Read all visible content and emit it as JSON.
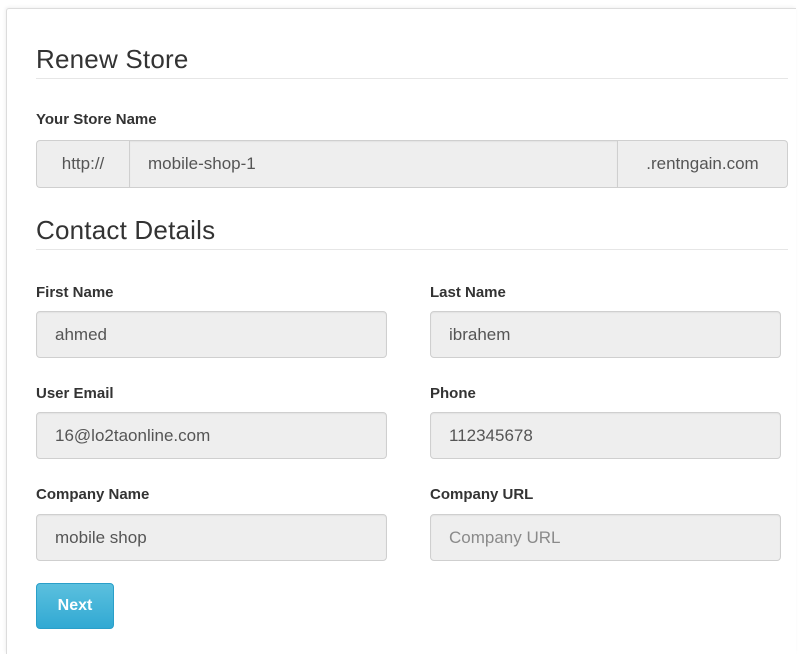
{
  "renew_section": {
    "title": "Renew Store",
    "store_name_label": "Your Store Name",
    "prefix": "http://",
    "store_name_value": "mobile-shop-1",
    "suffix": ".rentngain.com"
  },
  "contact_section": {
    "title": "Contact Details",
    "first_name": {
      "label": "First Name",
      "value": "ahmed",
      "placeholder": ""
    },
    "last_name": {
      "label": "Last Name",
      "value": "ibrahem",
      "placeholder": ""
    },
    "user_email": {
      "label": "User Email",
      "value": "16@lo2taonline.com",
      "placeholder": ""
    },
    "phone": {
      "label": "Phone",
      "value": "112345678",
      "placeholder": ""
    },
    "company_name": {
      "label": "Company Name",
      "value": "mobile shop",
      "placeholder": ""
    },
    "company_url": {
      "label": "Company URL",
      "value": "",
      "placeholder": "Company URL"
    }
  },
  "actions": {
    "next_label": "Next"
  },
  "colors": {
    "primary_button": "#39b3d7",
    "field_background": "#eeeeee",
    "text": "#333333"
  }
}
